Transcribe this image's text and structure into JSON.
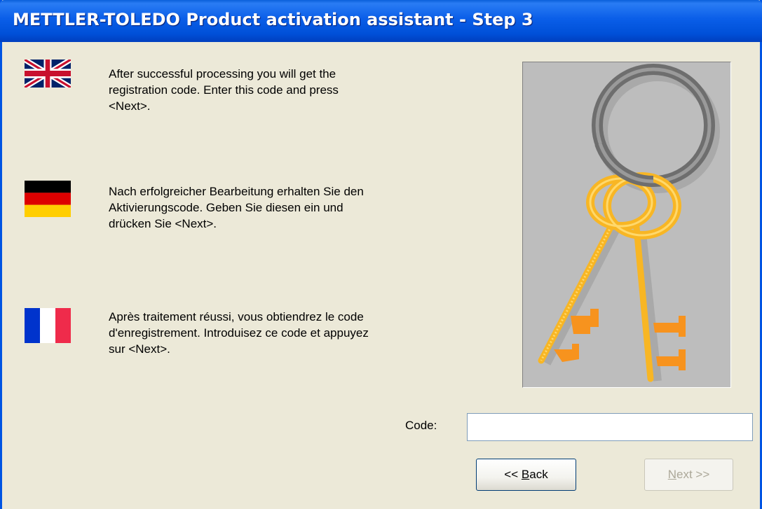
{
  "window": {
    "title": "METTLER-TOLEDO Product activation assistant - Step 3"
  },
  "messages": {
    "english": {
      "flag_icon": "uk-flag-icon",
      "lines": [
        "After successful processing you will get the",
        "registration code. Enter this code and press",
        "<Next>."
      ]
    },
    "german": {
      "flag_icon": "germany-flag-icon",
      "lines": [
        "Nach erfolgreicher Bearbeitung erhalten Sie den",
        "Aktivierungscode. Geben Sie diesen ein und",
        "drücken Sie <Next>."
      ]
    },
    "french": {
      "flag_icon": "france-flag-icon",
      "lines": [
        "Après traitement réussi, vous obtiendrez le code",
        "d'enregistrement. Introduisez ce code et appuyez",
        "sur <Next>."
      ]
    }
  },
  "illustration": {
    "icon": "keys-on-ring-icon"
  },
  "code_field": {
    "label": "Code:",
    "value": ""
  },
  "buttons": {
    "back": {
      "prefix": "<< ",
      "mnemonic": "B",
      "rest": "ack",
      "enabled": true
    },
    "next": {
      "mnemonic": "N",
      "rest": "ext >>",
      "enabled": false
    }
  },
  "colors": {
    "titlebar": "#0054e3",
    "window_bg": "#ece9d8",
    "key_gold": "#f8b624",
    "key_bits": "#f7931e",
    "ring_gray": "#777777"
  }
}
